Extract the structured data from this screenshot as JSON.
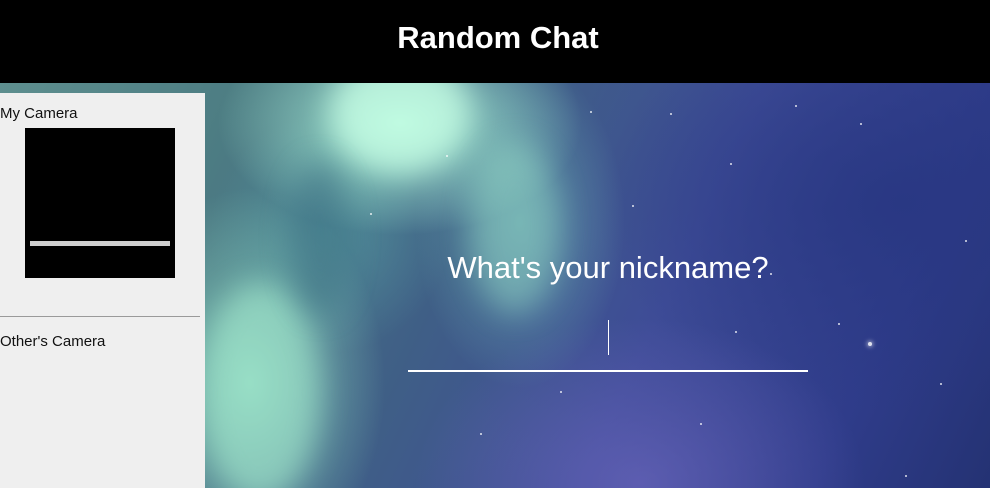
{
  "header": {
    "title": "Random Chat"
  },
  "sidebar": {
    "my_camera_label": "My Camera",
    "others_camera_label": "Other's Camera"
  },
  "nickname": {
    "prompt": "What's your nickname?",
    "value": "",
    "placeholder": ""
  },
  "colors": {
    "header_bg": "#000000",
    "sidebar_bg": "#efefef",
    "accent_text": "#ffffff"
  }
}
